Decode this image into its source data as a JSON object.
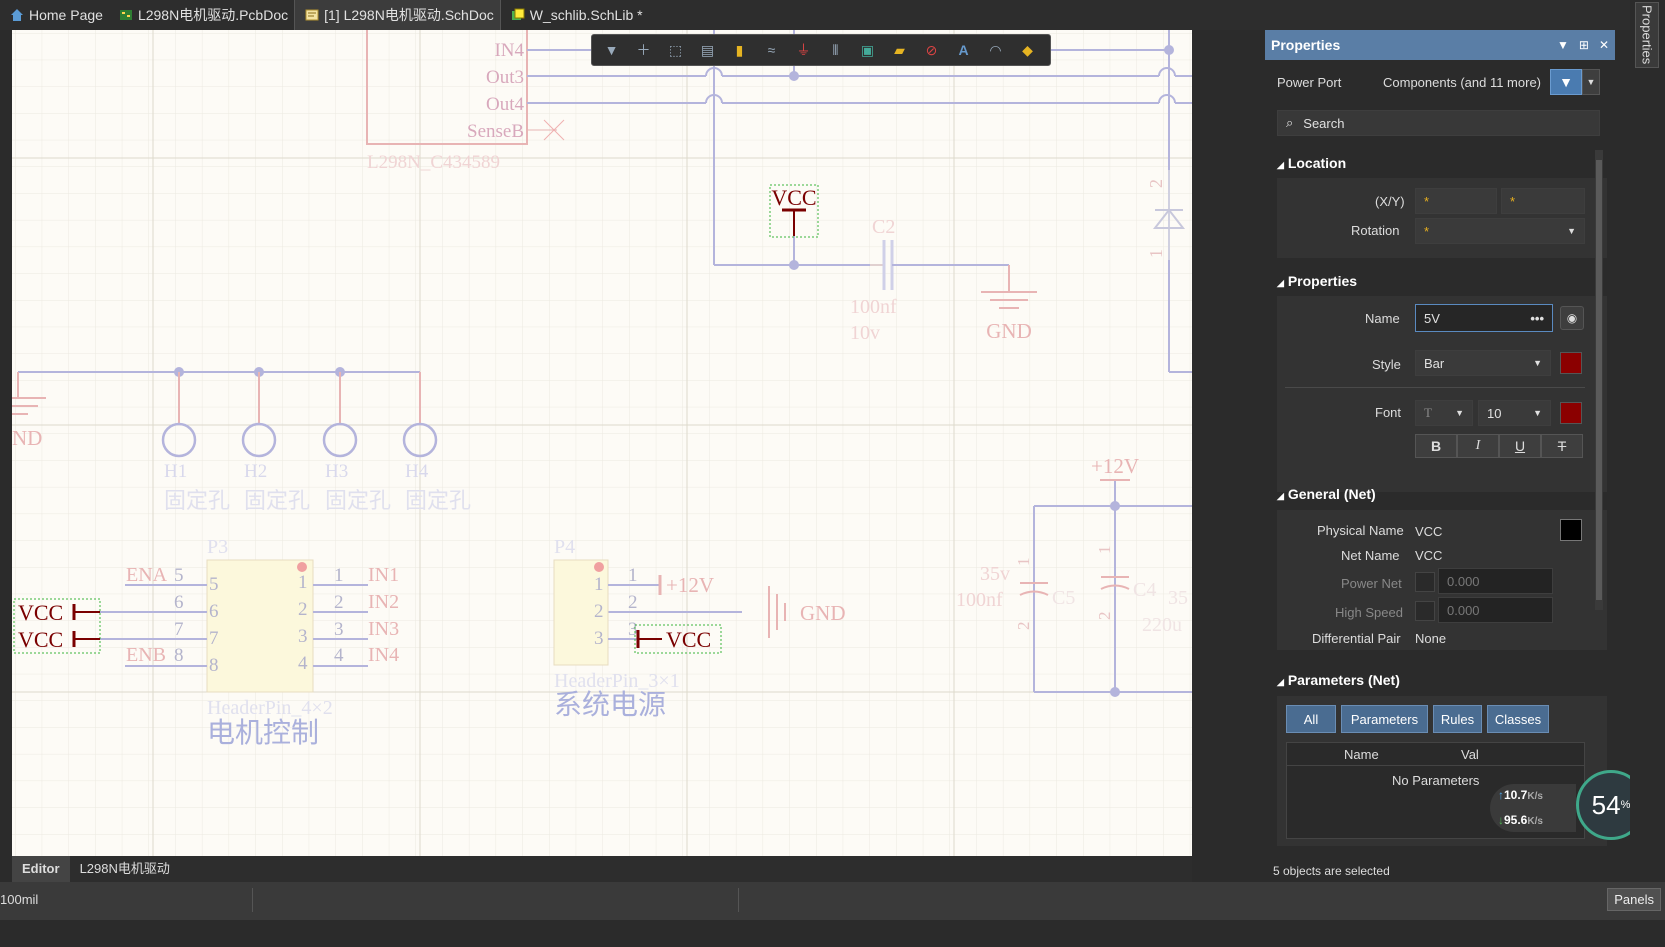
{
  "tabs": [
    {
      "label": "Home Page",
      "icon": "home-icon",
      "active": false
    },
    {
      "label": "L298N电机驱动.PcbDoc",
      "icon": "pcb-doc-icon",
      "active": false
    },
    {
      "label": "[1] L298N电机驱动.SchDoc",
      "icon": "sch-doc-icon",
      "active": true
    },
    {
      "label": "W_schlib.SchLib *",
      "icon": "schlib-icon",
      "active": false
    }
  ],
  "editor_tabs": [
    "Editor",
    "L298N电机驱动"
  ],
  "status": {
    "grid": "100mil",
    "panels": "Panels",
    "selection": "5 objects are selected"
  },
  "side_tab": "Properties",
  "properties": {
    "title": "Properties",
    "object_kind": "Power Port",
    "filter_text": "Components (and 11 more)",
    "search_placeholder": "Search",
    "location": {
      "title": "Location",
      "xy_label": "(X/Y)",
      "x_value": "*",
      "y_value": "*",
      "rotation_label": "Rotation",
      "rotation_value": "*"
    },
    "props_section": {
      "title": "Properties",
      "name_label": "Name",
      "name_value": "5V",
      "style_label": "Style",
      "style_value": "Bar",
      "style_color": "#8b0000",
      "font_label": "Font",
      "font_face": "T",
      "font_size": "10",
      "font_color": "#8b0000",
      "format_buttons": [
        "B",
        "I",
        "U",
        "T"
      ]
    },
    "general_net": {
      "title": "General (Net)",
      "physical_name_label": "Physical Name",
      "physical_name": "VCC",
      "net_name_label": "Net Name",
      "net_name": "VCC",
      "power_net_label": "Power Net",
      "power_net_value": "0.000",
      "high_speed_label": "High Speed",
      "high_speed_value": "0.000",
      "diff_pair_label": "Differential Pair",
      "diff_pair_value": "None",
      "net_color": "#000000"
    },
    "parameters_net": {
      "title": "Parameters (Net)",
      "buttons": [
        "All",
        "Parameters",
        "Rules",
        "Classes"
      ],
      "col_name": "Name",
      "col_value": "Val",
      "empty_text": "No Parameters"
    }
  },
  "net_monitor": {
    "upload": "10.7",
    "download": "95.6",
    "unit": "K/s",
    "percent": "54",
    "percent_sign": "%"
  },
  "schematic": {
    "l298n_pins": [
      "IN4",
      "Out3",
      "Out4",
      "SenseB"
    ],
    "l298n_label": "L298N_C434589",
    "vcc_label": "VCC",
    "c2": {
      "ref": "C2",
      "value1": "100nf",
      "value2": "10v"
    },
    "gnd_label": "GND",
    "holes": [
      {
        "ref": "H1",
        "desc": "固定孔"
      },
      {
        "ref": "H2",
        "desc": "固定孔"
      },
      {
        "ref": "H3",
        "desc": "固定孔"
      },
      {
        "ref": "H4",
        "desc": "固定孔"
      }
    ],
    "gnd_partial": "ND",
    "p3": {
      "ref": "P3",
      "part": "HeaderPin_4×2",
      "title": "电机控制",
      "left_nets": [
        "ENA",
        "",
        "",
        "ENB"
      ],
      "left_pins": [
        "5",
        "6",
        "7",
        "8"
      ],
      "right_pins": [
        "1",
        "2",
        "3",
        "4"
      ],
      "right_nets": [
        "IN1",
        "IN2",
        "IN3",
        "IN4"
      ]
    },
    "p4": {
      "ref": "P4",
      "part": "HeaderPin_3×1",
      "title": "系统电源",
      "pins": [
        "1",
        "2",
        "3"
      ],
      "nets": [
        "+12V",
        "GND",
        "VCC"
      ]
    },
    "vcc_left": [
      "VCC",
      "VCC"
    ],
    "plus12v": "+12V",
    "c5": {
      "ref": "C5",
      "value1": "35v",
      "value2": "100nf"
    },
    "c4": {
      "ref": "C4",
      "value1": "35",
      "value2": "220u"
    },
    "cap_pins": [
      "1",
      "2"
    ],
    "diode_pins": [
      "2",
      "1"
    ]
  }
}
